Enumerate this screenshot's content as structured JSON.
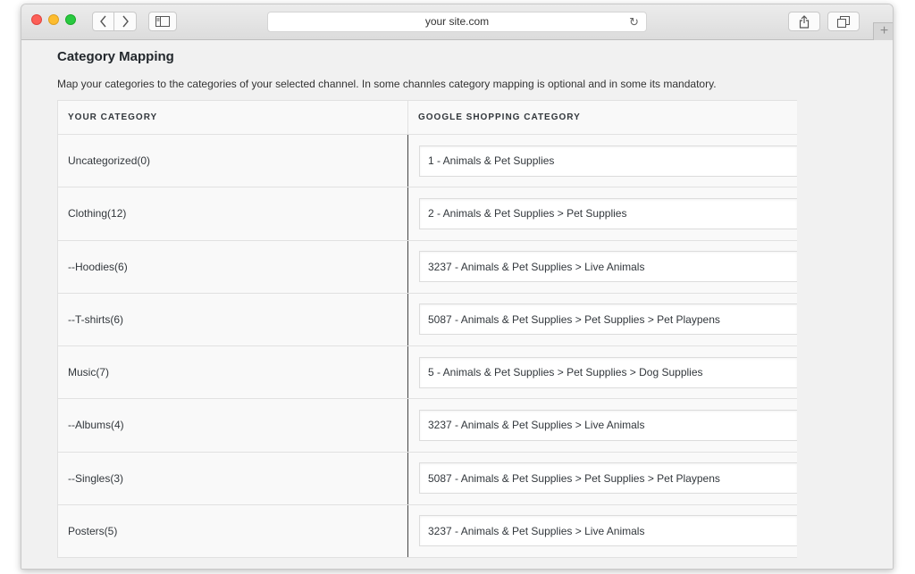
{
  "browser": {
    "address": "your site.com"
  },
  "page": {
    "title": "Category Mapping",
    "description": "Map your categories to the categories of your selected channel. In some channles category mapping is optional and in some its mandatory."
  },
  "table": {
    "headers": [
      "YOUR CATEGORY",
      "GOOGLE SHOPPING CATEGORY"
    ],
    "rows": [
      {
        "category": "Uncategorized(0)",
        "mapping": "1 - Animals & Pet Supplies"
      },
      {
        "category": "Clothing(12)",
        "mapping": "2 - Animals & Pet Supplies > Pet Supplies"
      },
      {
        "category": "--Hoodies(6)",
        "mapping": "3237 - Animals & Pet Supplies > Live Animals"
      },
      {
        "category": "--T-shirts(6)",
        "mapping": "5087 - Animals & Pet Supplies > Pet Supplies > Pet Playpens"
      },
      {
        "category": "Music(7)",
        "mapping": "5 - Animals & Pet Supplies > Pet Supplies > Dog Supplies"
      },
      {
        "category": "--Albums(4)",
        "mapping": "3237 - Animals & Pet Supplies > Live Animals"
      },
      {
        "category": "--Singles(3)",
        "mapping": "5087 - Animals & Pet Supplies > Pet Supplies > Pet Playpens"
      },
      {
        "category": "Posters(5)",
        "mapping": "3237 - Animals & Pet Supplies > Live Animals"
      }
    ]
  },
  "icons": {
    "back": "chevron-left-icon",
    "forward": "chevron-right-icon",
    "sidebar": "sidebar-icon",
    "reload": "reload-icon",
    "share": "share-icon",
    "tabs": "tabs-icon",
    "new_tab": "plus-icon"
  }
}
